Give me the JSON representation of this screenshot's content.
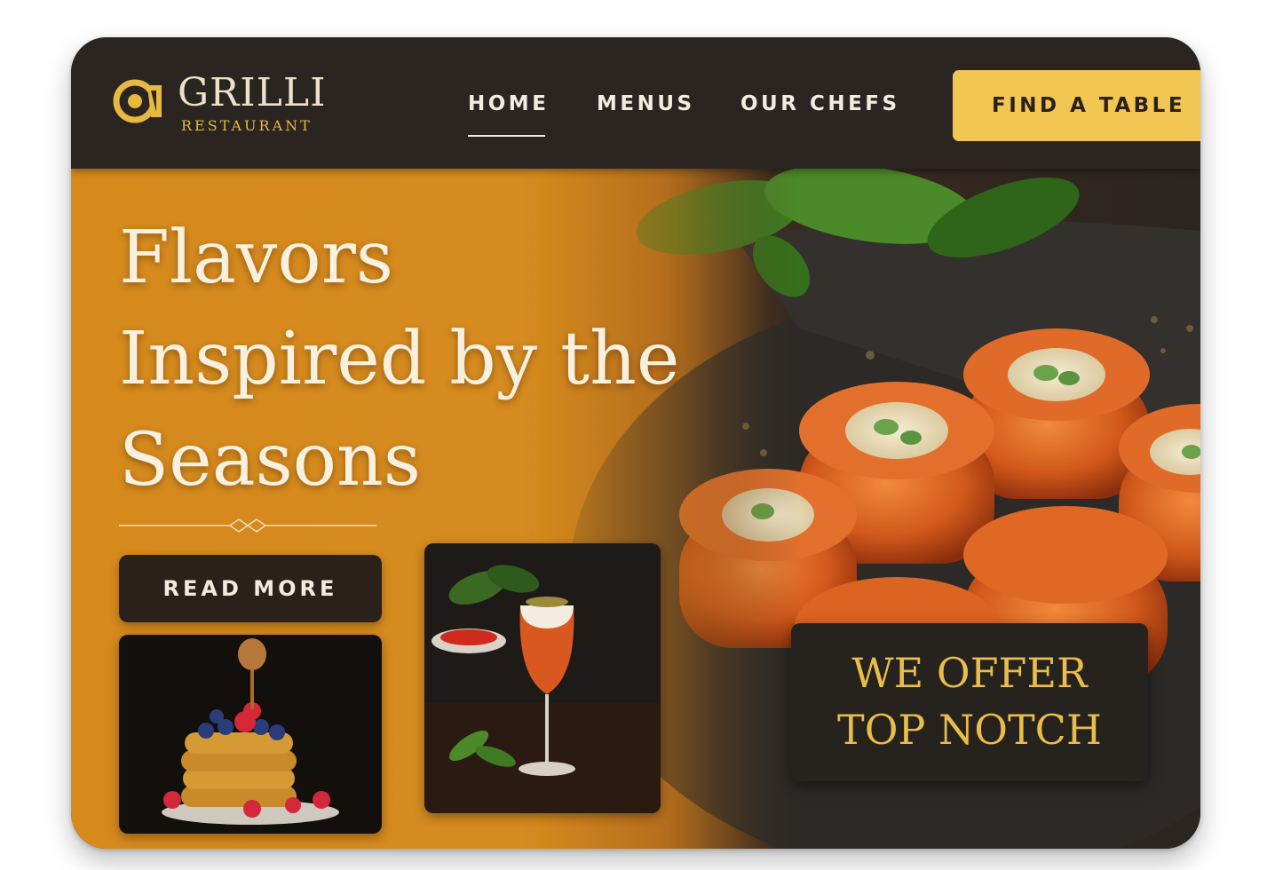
{
  "brand": {
    "name": "GRILLI",
    "tagline": "RESTAURANT",
    "logo_icon": "restaurant-logo-icon",
    "accent_color": "#f1c653"
  },
  "nav": {
    "links": [
      {
        "label": "HOME",
        "active": true
      },
      {
        "label": "MENUS",
        "active": false
      },
      {
        "label": "OUR CHEFS",
        "active": false
      }
    ],
    "cta_label": "FIND A TABLE"
  },
  "hero": {
    "headline": "Flavors Inspired by the Seasons",
    "read_more_label": "READ MORE",
    "offer_line1": "WE OFFER",
    "offer_line2": "TOP NOTCH"
  },
  "images": {
    "main": "glazed-rolls-photo",
    "pancakes": "pancake-stack-photo",
    "drink": "cocktail-glass-photo"
  }
}
